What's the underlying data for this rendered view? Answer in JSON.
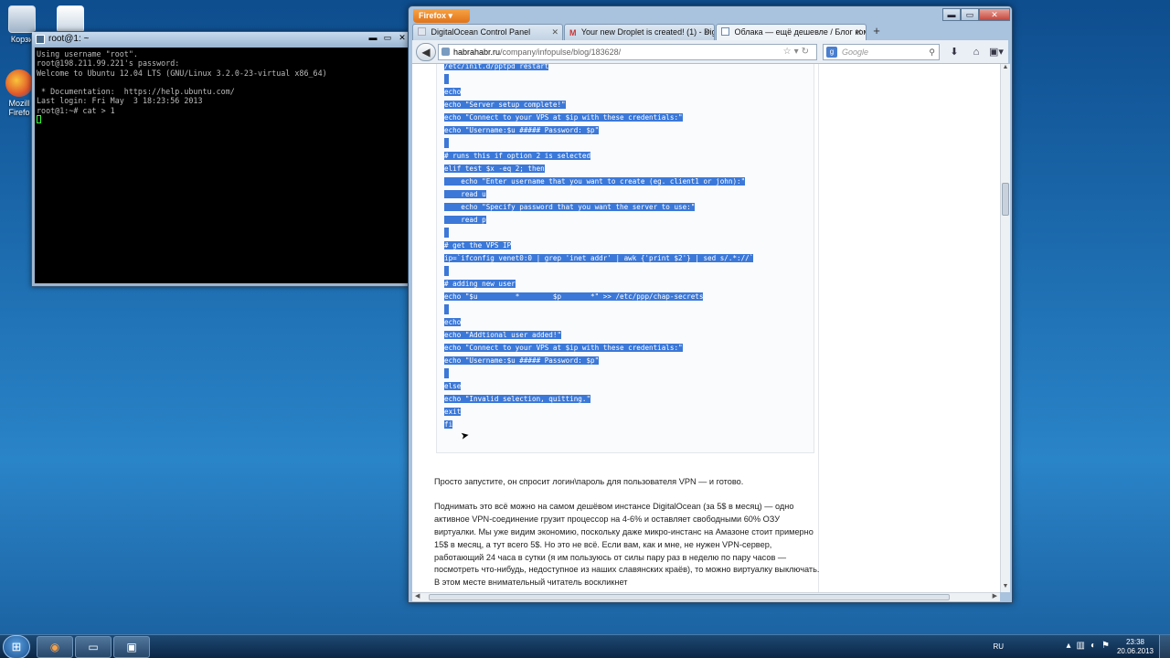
{
  "desktop": {
    "icons": [
      {
        "label": "Корзи",
        "icon": "recycle-bin-icon"
      },
      {
        "label": "",
        "icon": "computer-icon"
      },
      {
        "label": "Mozill Firefo",
        "icon": "firefox-icon"
      }
    ]
  },
  "putty": {
    "title": "root@1: ~",
    "terminal_lines": [
      "Using username \"root\".",
      "root@198.211.99.221's password:",
      "Welcome to Ubuntu 12.04 LTS (GNU/Linux 3.2.0-23-virtual x86_64)",
      "",
      " * Documentation:  https://help.ubuntu.com/",
      "Last login: Fri May  3 18:23:56 2013",
      "root@1:~# cat > 1"
    ]
  },
  "firefox": {
    "menu_label": "Firefox ▾",
    "tabs": [
      {
        "title": "DigitalOcean Control Panel",
        "icon": "digitalocean-favicon",
        "active": false
      },
      {
        "title": "Your new Droplet is created! (1) - Digi...",
        "icon": "gmail-favicon",
        "active": false
      },
      {
        "title": "Облака — ещё дешевле / Блог ком...",
        "icon": "habr-favicon",
        "active": true
      }
    ],
    "new_tab_label": "+",
    "url": {
      "host": "habrahabr.ru",
      "path": "/company/infopulse/blog/183628/"
    },
    "search_placeholder": "Google",
    "code_lines": [
      "/etc/init.d/pptpd restart",
      "",
      "echo",
      "echo \"Server setup complete!\"",
      "echo \"Connect to your VPS at $ip with these credentials:\"",
      "echo \"Username:$u ##### Password: $p\"",
      "",
      "# runs this if option 2 is selected",
      "elif test $x -eq 2; then",
      "    echo \"Enter username that you want to create (eg. client1 or john):\"",
      "    read u",
      "    echo \"Specify password that you want the server to use:\"",
      "    read p",
      "",
      "# get the VPS IP",
      "ip=`ifconfig venet0:0 | grep 'inet addr' | awk {'print $2'} | sed s/.*://`",
      "",
      "# adding new user",
      "echo \"$u         *        $p       *\" >> /etc/ppp/chap-secrets",
      "",
      "echo",
      "echo \"Addtional user added!\"",
      "echo \"Connect to your VPS at $ip with these credentials:\"",
      "echo \"Username:$u ##### Password: $p\"",
      "",
      "else",
      "echo \"Invalid selection, quitting.\"",
      "exit",
      "fi"
    ],
    "paragraphs": [
      "Просто запустите, он спросит логин\\пароль для пользователя VPN — и готово.",
      "Поднимать это всё можно на самом дешёвом инстансе DigitalOcean (за 5$ в месяц) — одно активное VPN-соединение грузит процессор на 4-6% и оставляет свободными 60% ОЗУ виртуалки. Мы уже видим экономию, поскольку даже микро-инстанс на Амазоне стоит примерно 15$ в месяц, а тут всего 5$. Но это не всё. Если вам, как и мне, не нужен VPN-сервер, работающий 24 часа в сутки (я им пользуюсь от силы пару раз в неделю по пару часов — посмотреть что-нибудь, недоступное из наших славянских краёв), то можно виртуалку выключать. В этом месте внимательный читатель воскликнет"
    ]
  },
  "taskbar": {
    "start_label": "⊞",
    "buttons": [
      {
        "name": "firefox",
        "glyph": "◉"
      },
      {
        "name": "explorer",
        "glyph": "▭"
      },
      {
        "name": "putty",
        "glyph": "▣"
      }
    ],
    "language": "RU",
    "time": "23:38",
    "date": "20.06.2013"
  }
}
